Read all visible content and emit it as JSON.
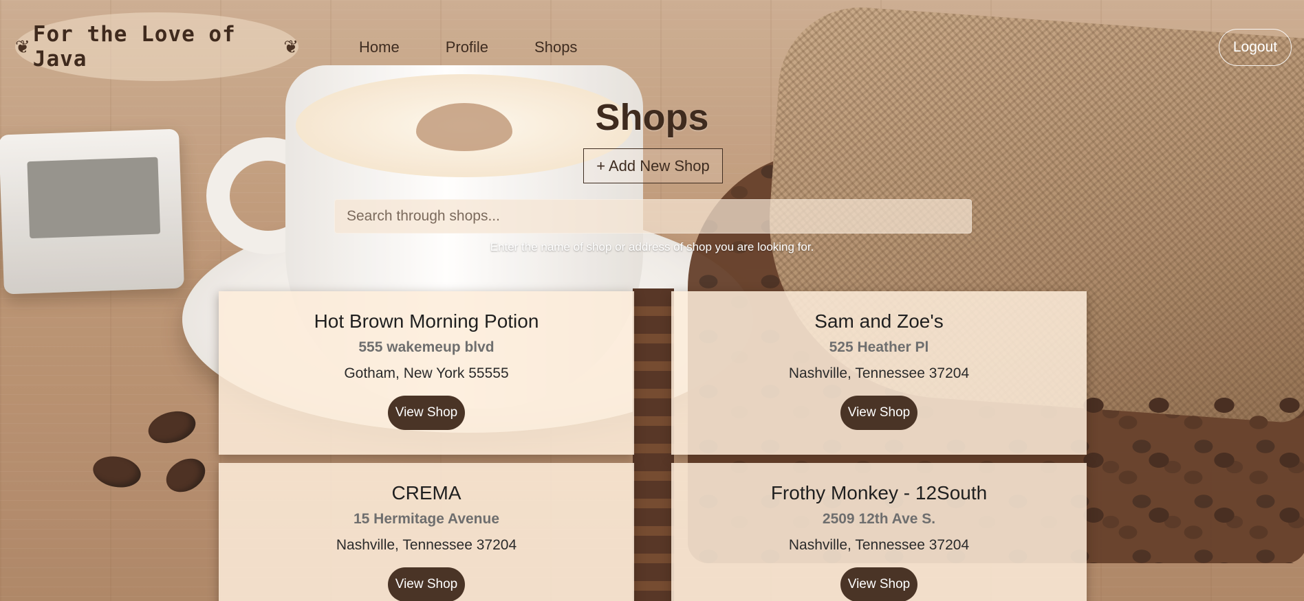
{
  "brand": {
    "name": "For the Love of Java"
  },
  "nav": {
    "items": [
      "Home",
      "Profile",
      "Shops"
    ],
    "logout": "Logout"
  },
  "header": {
    "title": "Shops",
    "add_button": "+ Add New Shop",
    "search_placeholder": "Search through shops...",
    "search_hint": "Enter the name of shop or address of shop you are looking for."
  },
  "shops": [
    {
      "name": "Hot Brown Morning Potion",
      "street": "555 wakemeup blvd",
      "city": "Gotham, New York 55555",
      "button": "View Shop"
    },
    {
      "name": "Sam and Zoe's",
      "street": "525 Heather Pl",
      "city": "Nashville, Tennessee 37204",
      "button": "View Shop"
    },
    {
      "name": "CREMA",
      "street": "15 Hermitage Avenue",
      "city": "Nashville, Tennessee 37204",
      "button": "View Shop"
    },
    {
      "name": "Frothy Monkey - 12South",
      "street": "2509 12th Ave S.",
      "city": "Nashville, Tennessee 37204",
      "button": "View Shop"
    }
  ],
  "colors": {
    "accent": "#4a3426",
    "card": "#fdecd9",
    "text_dark": "#3e2c20"
  },
  "icons": {
    "logo_ornament": "coffee-bean-icon"
  }
}
